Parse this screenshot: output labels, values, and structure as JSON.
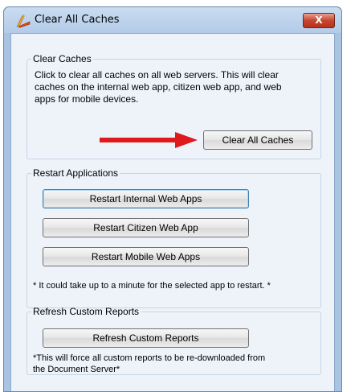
{
  "window": {
    "title": "Clear All Caches",
    "close_symbol": "X",
    "title_icon": "brush-icon"
  },
  "clear_caches": {
    "legend": "Clear Caches",
    "description_lines": [
      "Click to clear all caches on all web servers.  This will clear",
      "caches on the internal web app, citizen web app, and web",
      "apps for mobile devices."
    ],
    "button_label": "Clear All Caches",
    "arrow_color": "#e0191d"
  },
  "restart": {
    "legend": "Restart Applications",
    "buttons": [
      "Restart Internal Web Apps",
      "Restart Citizen Web App",
      "Restart Mobile Web Apps"
    ],
    "note": "* It could take up to a minute for the selected app to restart. *"
  },
  "refresh": {
    "legend": "Refresh Custom Reports",
    "button_label": "Refresh Custom Reports",
    "note_lines": [
      "*This will force all custom reports to be re-downloaded from",
      "the Document Server*"
    ]
  }
}
